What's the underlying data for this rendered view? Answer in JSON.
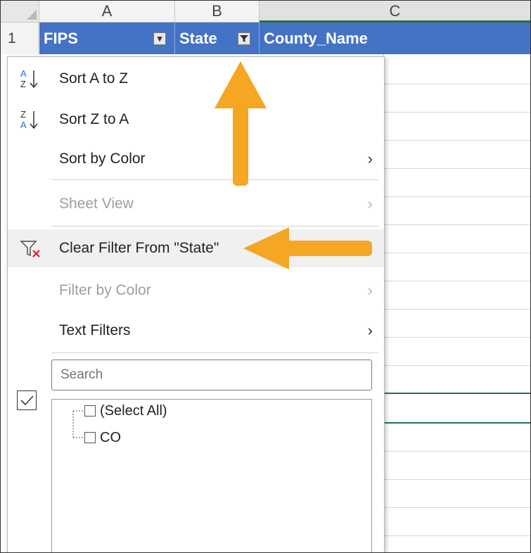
{
  "columns": {
    "a": "A",
    "b": "B",
    "c": "C"
  },
  "row_number": "1",
  "headers": {
    "fips": "FIPS",
    "state": "State",
    "county_name": "County_Name"
  },
  "menu": {
    "sort_az": "Sort A to Z",
    "sort_za": "Sort Z to A",
    "sort_by_color": "Sort by Color",
    "sheet_view": "Sheet View",
    "clear_filter": "Clear Filter From \"State\"",
    "filter_by_color": "Filter by Color",
    "text_filters": "Text Filters"
  },
  "search": {
    "placeholder": "Search"
  },
  "filter_list": [
    {
      "label": "(Select All)",
      "checked": false
    },
    {
      "label": "CO",
      "checked": false
    }
  ],
  "colors": {
    "header_fill": "#4472c4",
    "accent_arrow": "#f5a623",
    "selection_green": "#217346",
    "clear_x": "#e81123"
  },
  "icons": [
    "sort-az-icon",
    "sort-za-icon",
    "clear-filter-icon",
    "filter-dropdown-icon",
    "chevron-right-icon",
    "check-icon"
  ]
}
